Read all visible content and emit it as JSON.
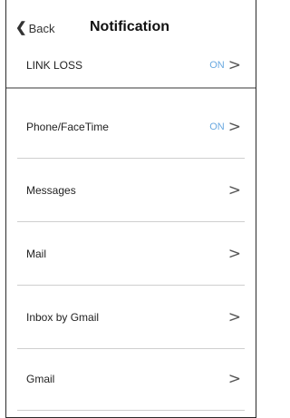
{
  "header": {
    "back_label": "Back",
    "title": "Notification"
  },
  "rows": [
    {
      "label": "LINK LOSS",
      "status": "ON"
    },
    {
      "label": "Phone/FaceTime",
      "status": "ON"
    },
    {
      "label": "Messages",
      "status": ""
    },
    {
      "label": "Mail",
      "status": ""
    },
    {
      "label": "Inbox by Gmail",
      "status": ""
    },
    {
      "label": "Gmail",
      "status": ""
    }
  ],
  "colors": {
    "status_on": "#6aa9e0"
  },
  "icons": {
    "back": "chevron-left-icon",
    "row": "chevron-right-icon"
  }
}
